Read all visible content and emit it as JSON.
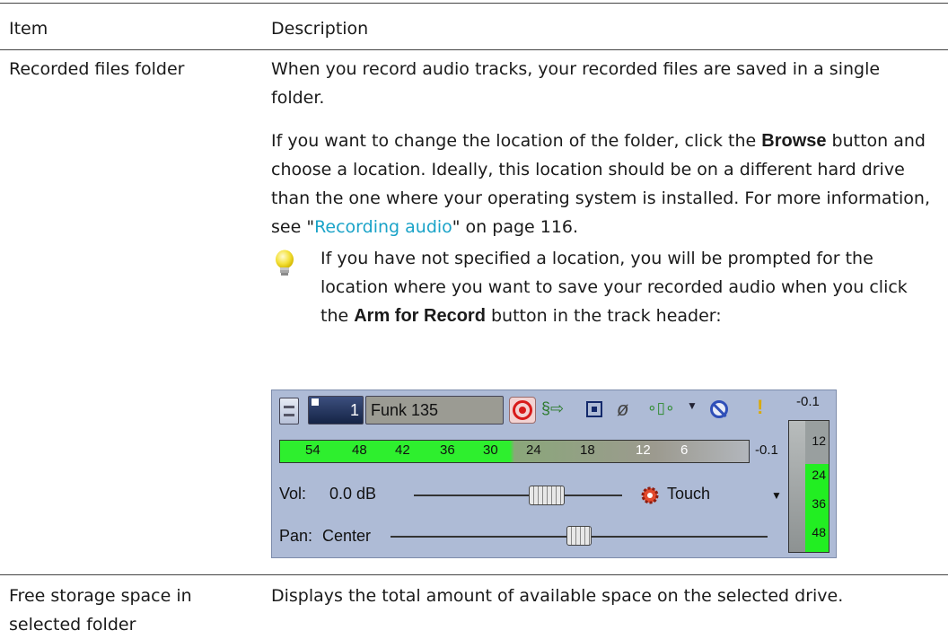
{
  "table": {
    "header": {
      "item": "Item",
      "description": "Description"
    },
    "rows": [
      {
        "item": "Recorded files folder",
        "para1": "When you record audio tracks, your recorded files are saved in a single folder.",
        "para2_a": "If you want to change the location of the folder, click the ",
        "para2_browse": "Browse",
        "para2_b": " button and choose a location. Ideally, this location should be on a different hard drive than the one where your operating system is installed. For more information, see \"",
        "para2_link": "Recording audio",
        "para2_c": "\" on page 116.",
        "tip_a": "If you have not specified a location, you will be prompted for the location where you want to save your recorded audio when you click the ",
        "tip_bold": "Arm for Record",
        "tip_b": " button in the track header:",
        "tip_icon": "lightbulb-icon"
      },
      {
        "item": "Free storage space in selected folder",
        "description": "Displays the total amount of available space on the selected drive."
      }
    ]
  },
  "track_header": {
    "number": "1",
    "name": "Funk 135",
    "peak_top": "-0.1",
    "peak_meter": "-0.1",
    "meter_ticks": [
      "54",
      "48",
      "42",
      "36",
      "30",
      "24",
      "18",
      "12",
      "6"
    ],
    "vu_ticks": [
      "12",
      "24",
      "36",
      "48"
    ],
    "vol_label": "Vol:",
    "vol_value": "0.0 dB",
    "pan_label": "Pan:",
    "pan_value": "Center",
    "automation_mode": "Touch",
    "colors": {
      "background": "#aebbd6",
      "meter_green": "#2eef2e",
      "record_red": "#d81b1b"
    },
    "icons": [
      "track-menu-icon",
      "arm-for-record-icon",
      "input-fx-icon",
      "track-fx-icon",
      "automation-icon",
      "envelope-icon",
      "mute-icon",
      "solo-icon"
    ]
  }
}
